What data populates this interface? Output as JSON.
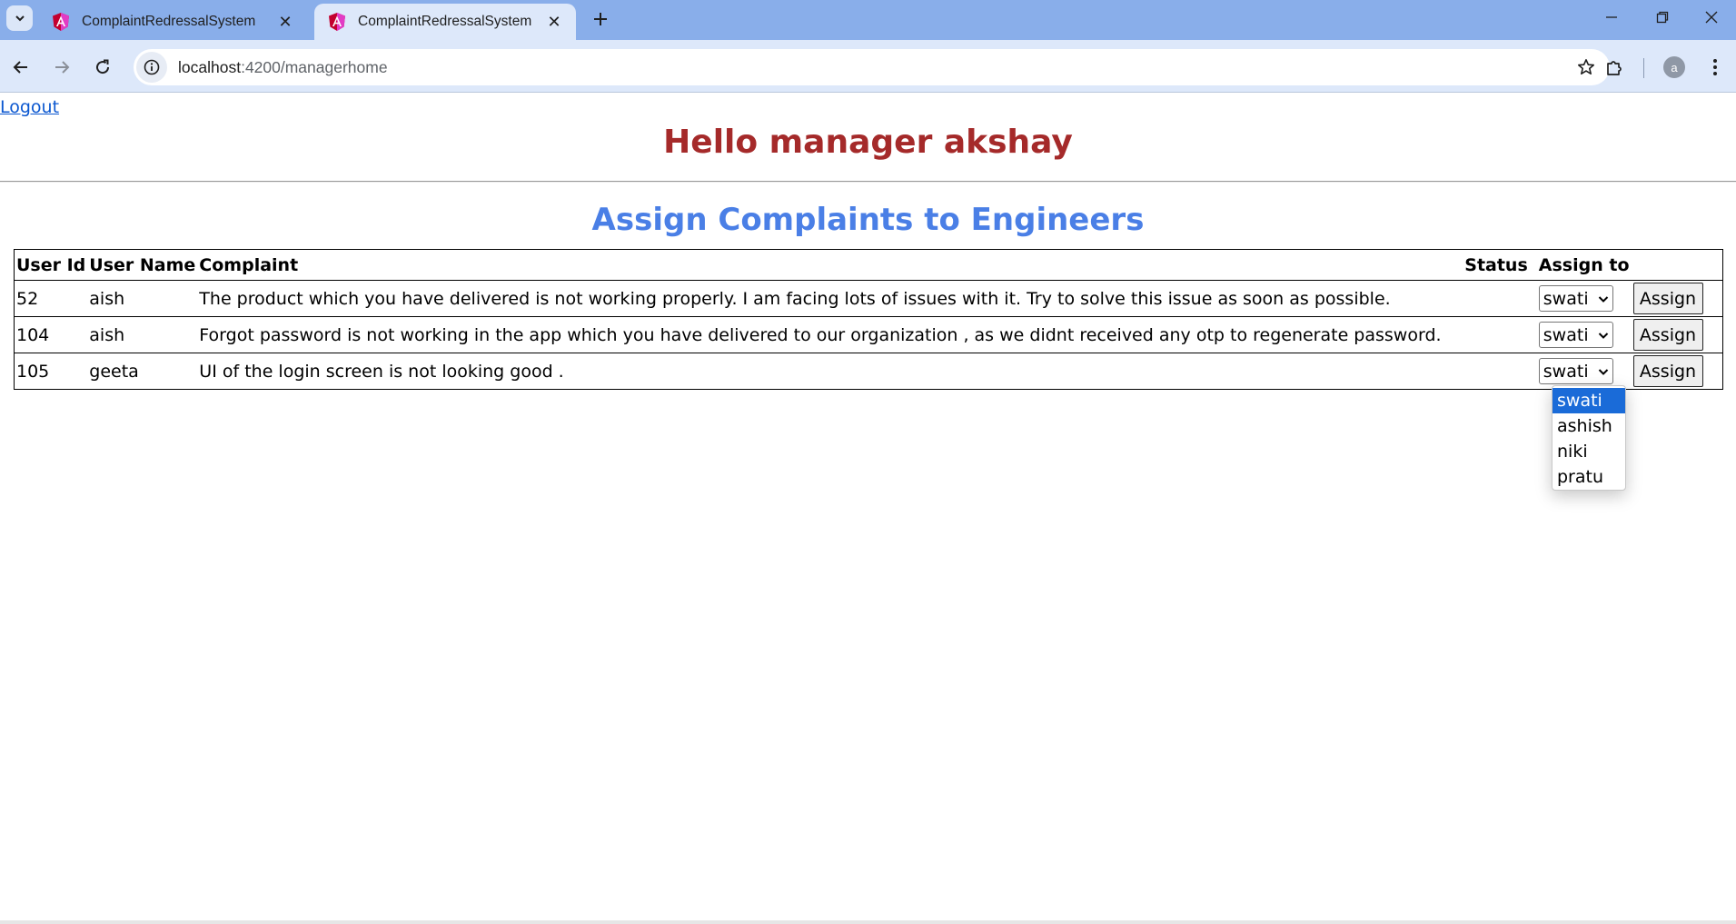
{
  "browser": {
    "tabs": [
      {
        "title": "ComplaintRedressalSystem",
        "active": false
      },
      {
        "title": "ComplaintRedressalSystem",
        "active": true
      }
    ],
    "url_host": "localhost",
    "url_path": ":4200/managerhome",
    "profile_initial": "a",
    "colors": {
      "tabstrip": "#89aeea",
      "toolbar": "#dde8fa"
    }
  },
  "page": {
    "logout_label": "Logout",
    "greeting": "Hello manager akshay",
    "section_title": "Assign Complaints to Engineers",
    "colors": {
      "greeting": "#a52a2a",
      "section_title": "#4a7fe6",
      "link": "#0b57d0"
    }
  },
  "table": {
    "headers": {
      "user_id": "User Id",
      "user_name": "User Name",
      "complaint": "Complaint",
      "status": "Status",
      "assign_to": "Assign to"
    },
    "rows": [
      {
        "user_id": "52",
        "user_name": "aish",
        "complaint": "The product which you have delivered is not working properly. I am facing lots of issues with it. Try to solve this issue as soon as possible.",
        "status": "",
        "assign_to": "swati",
        "button": "Assign"
      },
      {
        "user_id": "104",
        "user_name": "aish",
        "complaint": "Forgot password is not working in the app which you have delivered to our organization , as we didnt received any otp to regenerate password.",
        "status": "",
        "assign_to": "swati",
        "button": "Assign"
      },
      {
        "user_id": "105",
        "user_name": "geeta",
        "complaint": "UI of the login screen is not looking good .",
        "status": "",
        "assign_to": "swati",
        "button": "Assign"
      }
    ]
  },
  "dropdown": {
    "open_for_row": "105",
    "options": [
      "swati",
      "ashish",
      "niki",
      "pratu"
    ],
    "highlighted": "swati"
  }
}
